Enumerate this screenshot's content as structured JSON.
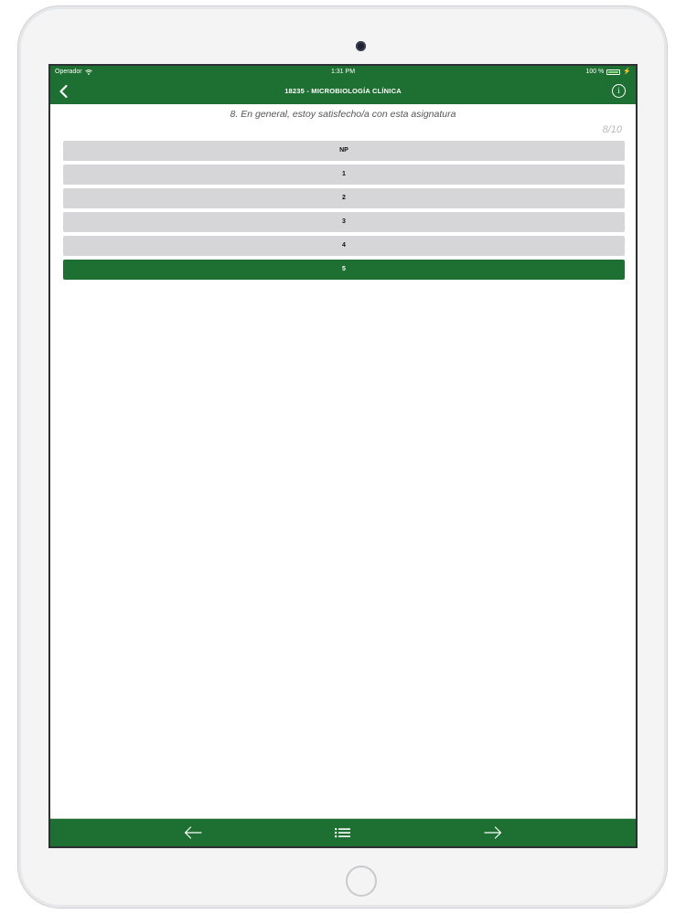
{
  "status_bar": {
    "carrier": "Operador",
    "time": "1:31 PM",
    "battery": "100 %"
  },
  "nav": {
    "title": "18235 - MICROBIOLOGÍA CLÍNICA",
    "info_label": "i"
  },
  "survey": {
    "question": "8. En general, estoy satisfecho/a con esta asignatura",
    "progress": "8/10",
    "options": [
      {
        "label": "NP",
        "selected": false
      },
      {
        "label": "1",
        "selected": false
      },
      {
        "label": "2",
        "selected": false
      },
      {
        "label": "3",
        "selected": false
      },
      {
        "label": "4",
        "selected": false
      },
      {
        "label": "5",
        "selected": true
      }
    ]
  },
  "toolbar": {
    "prev_icon": "arrow-left-icon",
    "list_icon": "list-icon",
    "next_icon": "arrow-right-icon"
  },
  "colors": {
    "brand_green": "#1e6f32",
    "option_gray": "#d6d6d8"
  }
}
